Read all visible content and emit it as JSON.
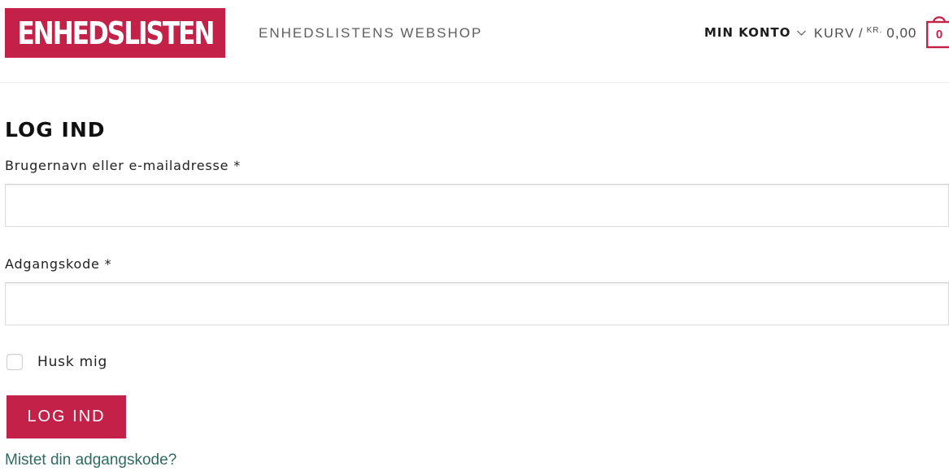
{
  "header": {
    "logo_text": "ENHEDSLISTEN",
    "tagline": "ENHEDSLISTENS WEBSHOP",
    "account_label": "MIN KONTO",
    "cart_label": "KURV",
    "cart_separator": "/",
    "cart_currency": "KR.",
    "cart_amount": "0,00",
    "cart_count": "0"
  },
  "login": {
    "title": "LOG IND",
    "username_label": "Brugernavn eller e-mailadresse *",
    "username_value": "",
    "password_label": "Adgangskode *",
    "password_value": "",
    "remember_label": "Husk mig",
    "submit_label": "LOG IND",
    "lost_password_label": "Mistet din adgangskode?"
  },
  "icons": {
    "account_dropdown": "chevron-down-icon",
    "cart": "shopping-bag-icon"
  },
  "colors": {
    "brand": "#c32148",
    "link": "#2f6b62",
    "text": "#222222"
  }
}
